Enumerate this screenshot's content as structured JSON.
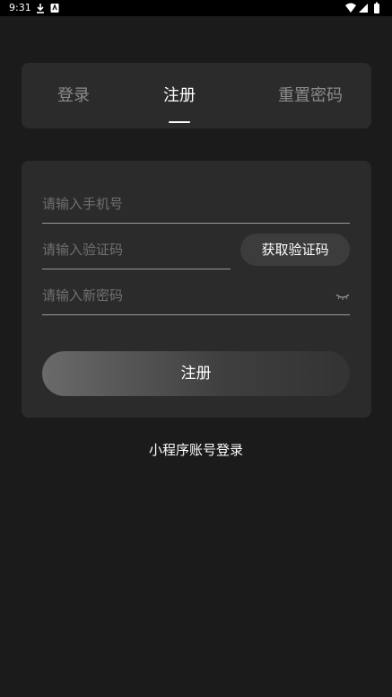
{
  "status_bar": {
    "time": "9:31",
    "icons": [
      "download-icon",
      "notification-icon",
      "wifi-icon",
      "signal-icon",
      "battery-icon"
    ]
  },
  "tabs": [
    {
      "label": "登录",
      "active": false
    },
    {
      "label": "注册",
      "active": true
    },
    {
      "label": "重置密码",
      "active": false
    }
  ],
  "form": {
    "phone_placeholder": "请输入手机号",
    "code_placeholder": "请输入验证码",
    "get_code_label": "获取验证码",
    "password_placeholder": "请输入新密码",
    "submit_label": "注册"
  },
  "mini_program_login_label": "小程序账号登录",
  "colors": {
    "background": "#1b1b1b",
    "card": "#2b2b2b",
    "text_active": "#ffffff",
    "text_inactive": "#8c8c8c"
  }
}
